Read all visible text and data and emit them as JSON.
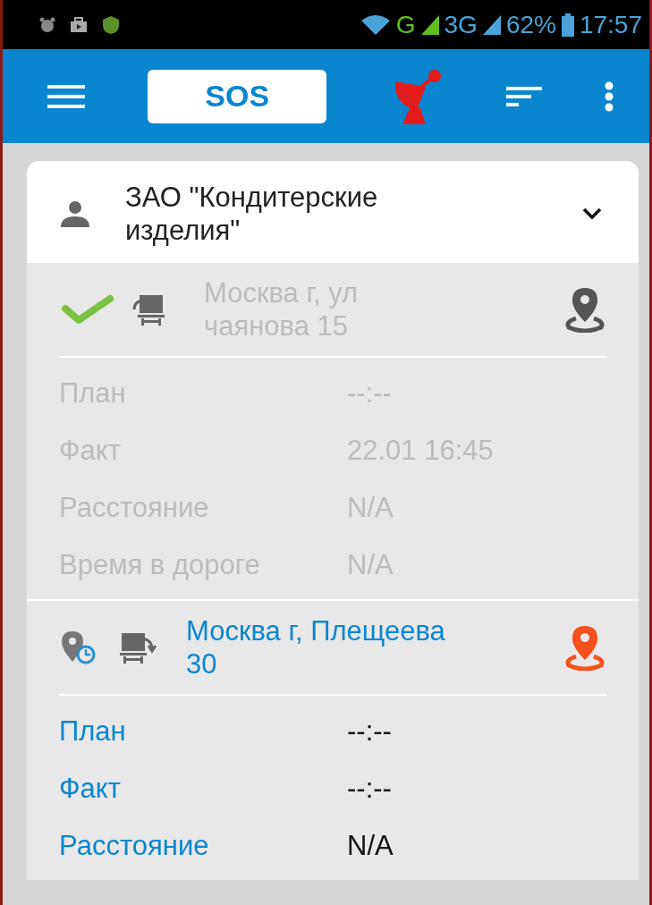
{
  "status_bar": {
    "network_1": "G",
    "network_2": "3G",
    "battery": "62%",
    "time": "17:57"
  },
  "app_bar": {
    "sos_button": "SOS"
  },
  "client": {
    "name": "ЗАО \"Кондитерские изделия\"",
    "expanded": true
  },
  "stops": [
    {
      "completed": true,
      "kind": "load",
      "address": "Москва г, ул чаянова 15",
      "rows": [
        {
          "label": "План",
          "value": "--:--"
        },
        {
          "label": "Факт",
          "value": "22.01 16:45"
        },
        {
          "label": "Расстояние",
          "value": "N/A"
        },
        {
          "label": "Время в дороге",
          "value": "N/A"
        }
      ]
    },
    {
      "completed": false,
      "kind": "unload",
      "address": "Москва г, Плещеева 30",
      "rows": [
        {
          "label": "План",
          "value": "--:--"
        },
        {
          "label": "Факт",
          "value": "--:--"
        },
        {
          "label": "Расстояние",
          "value": "N/A"
        }
      ]
    }
  ]
}
